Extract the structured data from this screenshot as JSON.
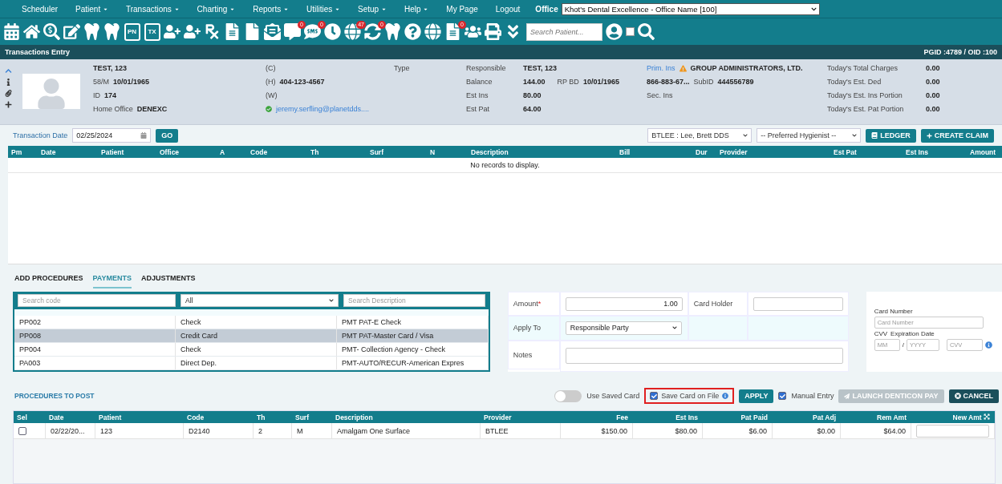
{
  "menu": {
    "items": [
      {
        "label": "Scheduler",
        "caret": false
      },
      {
        "label": "Patient",
        "caret": true
      },
      {
        "label": "Transactions",
        "caret": true
      },
      {
        "label": "Charting",
        "caret": true
      },
      {
        "label": "Reports",
        "caret": true
      },
      {
        "label": "Utilities",
        "caret": true
      },
      {
        "label": "Setup",
        "caret": true
      },
      {
        "label": "Help",
        "caret": true
      },
      {
        "label": "My Page",
        "caret": false
      },
      {
        "label": "Logout",
        "caret": false
      }
    ],
    "office_label": "Office",
    "office_value": "Khot's Dental Excellence - Office Name [100]"
  },
  "toolbar": {
    "icons": [
      {
        "kind": "calendar"
      },
      {
        "kind": "home"
      },
      {
        "kind": "dollar"
      },
      {
        "kind": "notes"
      },
      {
        "kind": "tooth"
      },
      {
        "kind": "tooth"
      },
      {
        "kind": "text",
        "label": "PN"
      },
      {
        "kind": "text",
        "label": "TX"
      },
      {
        "kind": "useradd"
      },
      {
        "kind": "useradd"
      },
      {
        "kind": "rx"
      },
      {
        "kind": "doc"
      },
      {
        "kind": "file"
      },
      {
        "kind": "mail"
      },
      {
        "kind": "chat",
        "badge": "0"
      },
      {
        "kind": "sms",
        "badge": "0"
      },
      {
        "kind": "clock"
      },
      {
        "kind": "globe",
        "badge": "47"
      },
      {
        "kind": "sync",
        "badge": "0"
      },
      {
        "kind": "tooth"
      },
      {
        "kind": "help"
      },
      {
        "kind": "globe"
      },
      {
        "kind": "doc",
        "badge": "0"
      },
      {
        "kind": "people"
      },
      {
        "kind": "printer"
      },
      {
        "kind": "chevrons"
      }
    ],
    "search_placeholder": "Search Patient...",
    "checkbox_checked": false
  },
  "title_bar": {
    "title": "Transactions Entry",
    "ids": "PGID :4789 / OID :100"
  },
  "patient": {
    "name": "TEST, 123",
    "age_sex": "58/M",
    "birth_date": "10/01/1965",
    "id_label": "ID",
    "id": "174",
    "home_office_label": "Home Office",
    "home_office": "DENEXC",
    "contacts": [
      {
        "label": "(C)"
      },
      {
        "label": "(H)",
        "value": "404-123-4567"
      },
      {
        "label": "(W)"
      }
    ],
    "email": "jeremy.serfling@planetdds....",
    "type_label": "Type",
    "responsible": [
      {
        "label": "Responsible",
        "value": "TEST, 123"
      },
      {
        "label": "Balance",
        "value": "144.00"
      },
      {
        "label": "Est Ins",
        "value": "80.00"
      },
      {
        "label": "Est Pat",
        "value": "64.00"
      }
    ],
    "rp_bd_label": "RP BD",
    "rp_bd": "10/01/1965",
    "prim_ins_label": "Prim. Ins",
    "prim_ins": "GROUP ADMINISTRATORS, LTD.",
    "phone": "866-883-67...",
    "subid_label": "SubID",
    "subid": "444556789",
    "sec_ins_label": "Sec. Ins",
    "today": [
      {
        "label": "Today's Total Charges",
        "value": "0.00"
      },
      {
        "label": "Today's Est. Ded",
        "value": "0.00"
      },
      {
        "label": "Today's Est. Ins Portion",
        "value": "0.00"
      },
      {
        "label": "Today's Est. Pat Portion",
        "value": "0.00"
      }
    ]
  },
  "transaction_bar": {
    "date_label": "Transaction Date",
    "date": "02/25/2024",
    "go": "GO",
    "provider": "BTLEE : Lee, Brett DDS",
    "hygienist": "-- Preferred Hygienist --",
    "ledger": "LEDGER",
    "create_claim": "CREATE CLAIM"
  },
  "transactions_table": {
    "columns": [
      "Pm",
      "Date",
      "Patient",
      "Office",
      "A",
      "Code",
      "Th",
      "Surf",
      "N",
      "Description",
      "Bill",
      "Dur",
      "Provider",
      "Est Pat",
      "Est Ins",
      "Amount"
    ],
    "empty": "No records to display."
  },
  "tabs": [
    {
      "label": "ADD PROCEDURES",
      "selected": false
    },
    {
      "label": "PAYMENTS",
      "selected": true
    },
    {
      "label": "ADJUSTMENTS",
      "selected": false
    }
  ],
  "codes": {
    "code_placeholder": "Search code",
    "type_value": "All",
    "description_placeholder": "Search Description",
    "rows": [
      {
        "code": "PP002",
        "type": "Check",
        "description": "PMT PAT-E Check",
        "selected": false
      },
      {
        "code": "PP008",
        "type": "Credit Card",
        "description": "PMT PAT-Master Card / Visa",
        "selected": true
      },
      {
        "code": "PP004",
        "type": "Check",
        "description": "PMT- Collection Agency - Check",
        "selected": false
      },
      {
        "code": "PA003",
        "type": "Direct Dep.",
        "description": "PMT-AUTO/RECUR-American Expres",
        "selected": false
      }
    ]
  },
  "payment": {
    "amount_label": "Amount",
    "amount_mark": "*",
    "amount": "1.00",
    "card_holder_label": "Card Holder",
    "apply_to_label": "Apply To",
    "apply_to": "Responsible Party",
    "notes_label": "Notes",
    "card_number_label": "Card Number",
    "card_number_placeholder": "Card Number",
    "cvv_label": "CVV",
    "expiration_label": "Expiration Date",
    "month_placeholder": "MM",
    "separator": "/",
    "year_placeholder": "YYYY",
    "cvv_placeholder": "CVV"
  },
  "actions": {
    "use_saved_cards": {
      "label": "Use Saved Card",
      "on": false
    },
    "save_card": {
      "label": "Save Card on File",
      "checked": true
    },
    "apply": "APPLY",
    "manual_entry": {
      "label": "Manual Entry",
      "checked": true
    },
    "launch": {
      "label": "LAUNCH DENTICON PAY",
      "disabled": true
    },
    "cancel": "CANCEL"
  },
  "procedures": {
    "title": "PROCEDURES TO POST",
    "columns": [
      "Sel",
      "Date",
      "Patient",
      "Code",
      "Th",
      "Surf",
      "Description",
      "Provider",
      "Fee",
      "Est Ins",
      "Pat Paid",
      "Pat Adj",
      "Rem Amt",
      "New Amt"
    ],
    "rows": [
      {
        "checked": false,
        "cells": [
          "",
          "02/22/20...",
          "123",
          "D2140",
          "2",
          "M",
          "Amalgam One Surface",
          "BTLEE",
          "$150.00",
          "$80.00",
          "$6.00",
          "$0.00",
          "$64.00",
          ""
        ]
      }
    ]
  }
}
